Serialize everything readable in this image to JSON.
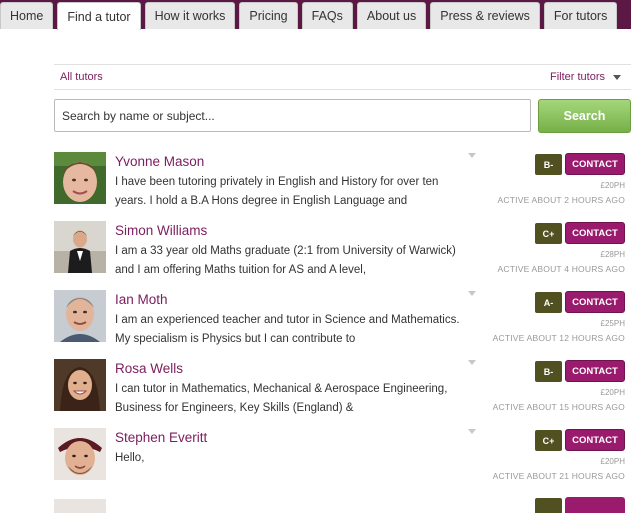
{
  "nav": {
    "tabs": [
      {
        "label": "Home"
      },
      {
        "label": "Find a tutor"
      },
      {
        "label": "How it works"
      },
      {
        "label": "Pricing"
      },
      {
        "label": "FAQs"
      },
      {
        "label": "About us"
      },
      {
        "label": "Press & reviews"
      },
      {
        "label": "For tutors"
      }
    ],
    "active_tab": "Find a tutor"
  },
  "filter": {
    "all_label": "All tutors",
    "filter_label": "Filter tutors"
  },
  "search": {
    "placeholder": "Search by name or subject...",
    "button_label": "Search"
  },
  "tutors": [
    {
      "name": "Yvonne Mason",
      "description": "I have been tutoring privately in English and History for over ten years. I hold a B.A Hons degree in English Language and",
      "grade": "B-",
      "contact": "CONTACT",
      "price": "£20PH",
      "active": "ACTIVE ABOUT 2 HOURS AGO"
    },
    {
      "name": "Simon Williams",
      "description": "I am a 33 year old Maths graduate (2:1 from University of Warwick) and I am offering Maths tuition for AS and A level,",
      "grade": "C+",
      "contact": "CONTACT",
      "price": "£28PH",
      "active": "ACTIVE ABOUT 4 HOURS AGO"
    },
    {
      "name": "Ian Moth",
      "description": "I am an experienced teacher and tutor in Science and Mathematics. My specialism is Physics but I can contribute to",
      "grade": "A-",
      "contact": "CONTACT",
      "price": "£25PH",
      "active": "ACTIVE ABOUT 12 HOURS AGO"
    },
    {
      "name": "Rosa Wells",
      "description": "I can tutor in Mathematics, Mechanical & Aerospace Engineering, Business for Engineers, Key Skills (England) &",
      "grade": "B-",
      "contact": "CONTACT",
      "price": "£20PH",
      "active": "ACTIVE ABOUT 15 HOURS AGO"
    },
    {
      "name": "Stephen Everitt",
      "description": "Hello,",
      "grade": "C+",
      "contact": "CONTACT",
      "price": "£20PH",
      "active": "ACTIVE ABOUT 21 HOURS AGO"
    }
  ],
  "colors": {
    "header_bg": "#5c1844",
    "link": "#7b1d5e",
    "contact_button": "#9a1b6d",
    "grade_badge": "#515021",
    "search_button": "#82bd55"
  }
}
